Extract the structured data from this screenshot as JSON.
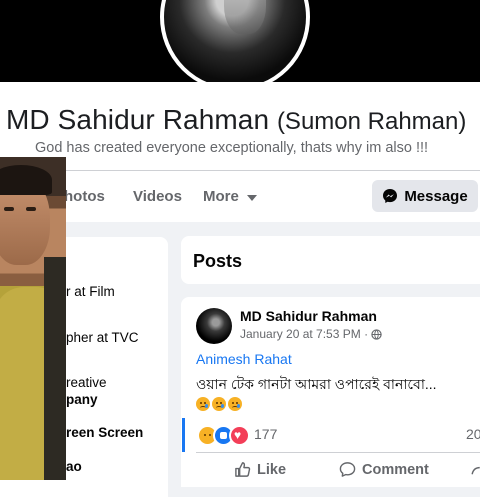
{
  "profile": {
    "name": "MD Sahidur Rahman",
    "alternate_name": "(Sumon Rahman)",
    "bio": "God has created everyone exceptionally, thats why im also !!!"
  },
  "tabs": {
    "photos": "hotos",
    "videos": "Videos",
    "more": "More"
  },
  "actions": {
    "message": "Message"
  },
  "intro": {
    "items": [
      "r at Film",
      "pher at TVC",
      "reative",
      "pany",
      "reen Screen",
      "ao"
    ]
  },
  "posts": {
    "title": "Posts"
  },
  "post": {
    "author": "MD Sahidur Rahman",
    "time": "January 20 at 7:53 PM ·",
    "tagged": "Animesh Rahat",
    "text": "ওয়ান টেক গানটা আমরা ওপারেই বানাবো...",
    "reaction_count": "177",
    "comment_count_partial": "20",
    "like_label": "Like",
    "comment_label": "Comment"
  },
  "colors": {
    "accent": "#1877f2",
    "secondary_text": "#65676b",
    "page_bg": "#f0f2f5"
  },
  "icons": [
    "messenger-icon",
    "globe-icon",
    "chevron-down-icon",
    "like-icon",
    "comment-icon",
    "share-icon"
  ]
}
